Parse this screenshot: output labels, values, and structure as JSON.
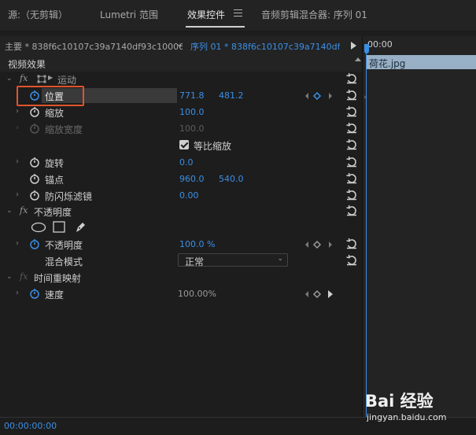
{
  "tabs": [
    {
      "label": "源:（无剪辑）"
    },
    {
      "label": "Lumetri 范围"
    },
    {
      "label": "效果控件"
    },
    {
      "label": "音频剪辑混合器: 序列 01"
    }
  ],
  "source": {
    "master": "主要 * 838f6c10107c39a7140df93c10006...",
    "sequence": "序列 01 * 838f6c10107c39a7140df93c..."
  },
  "panel": {
    "header": "视频效果",
    "motion": {
      "label": "运动"
    },
    "position": {
      "label": "位置",
      "x": "771.8",
      "y": "481.2"
    },
    "scale": {
      "label": "缩放",
      "value": "100.0"
    },
    "scale_width": {
      "label": "缩放宽度",
      "value": "100.0"
    },
    "uniform_scale": {
      "label": "等比缩放"
    },
    "rotation": {
      "label": "旋转",
      "value": "0.0"
    },
    "anchor": {
      "label": "锚点",
      "x": "960.0",
      "y": "540.0"
    },
    "antiflicker": {
      "label": "防闪烁滤镜",
      "value": "0.00"
    },
    "opacity_section": {
      "label": "不透明度"
    },
    "opacity": {
      "label": "不透明度",
      "value": "100.0 %"
    },
    "blend_mode": {
      "label": "混合模式",
      "value": "正常"
    },
    "time_remap": {
      "label": "时间重映射"
    },
    "speed": {
      "label": "速度",
      "value": "100.00%"
    }
  },
  "timeline": {
    "time": "00:00",
    "clip_name": "荷花.jpg"
  },
  "footer": {
    "time": "00:00:00:00"
  },
  "watermark": {
    "text": "Bai 经验",
    "url": "jingyan.baidu.com"
  },
  "colors": {
    "accent": "#3b8fe6",
    "highlight_box": "#e0542c"
  }
}
